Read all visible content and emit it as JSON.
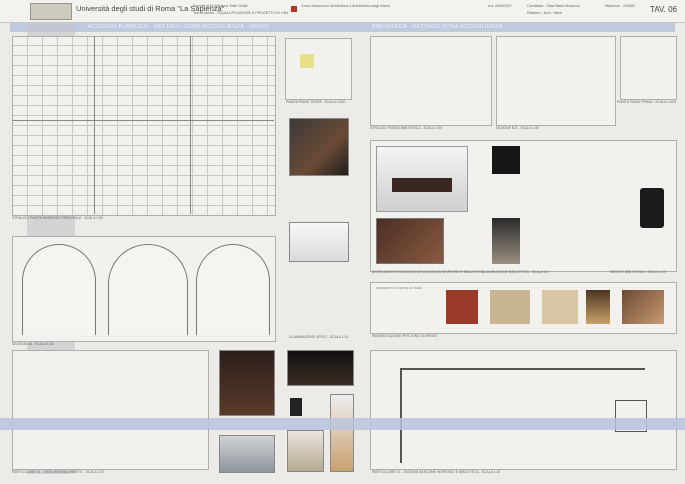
{
  "header": {
    "university": "Università degli studi di Roma \"La Sapienza\"",
    "faculty": "Facoltà di Architettura 'Valle Giulia'",
    "course": "Corso di laurea in Architettura e Architettura degli interni",
    "thesis": "Tesi di laurea - RIQUALIFICAZIONE E PROGETTO DI UNA BIBLIOTECA COMUNALE NELL'EX CONVENTO DI SANT'AGOSTINO AD ANDRIA, BARI",
    "year": "a.a. 2006/2007",
    "candidate": "Candidata - Elisa Maria Musacco",
    "matricola": "Matricola - 783650",
    "relatore": "Relatore - Arch. Valeri",
    "tav": "TAV. 06"
  },
  "bands": {
    "left_title": "ACCESSO PUBBLICO - DETTAGLI ZONA ACCOGLIENZA - UFFICI",
    "right_title": "BIBLIOTECA - DETTAGLI ZONA ACCOGLIENZA"
  },
  "captions": {
    "plan": "STRALCIO PIANTA INGRESSO PRINCIPALE - SCALA 1:50",
    "pianta_terra": "PIANTA PIANO TERRA - SCALA 1:500",
    "section": "SEZIONE AA - SCALA 1:50",
    "illum_uffici": "ILLUMINAZIONE UFFICI - SCALA 1:10",
    "detail_left": "PARTICOLARE 01 - VISTA INTERNA PARETE - SCALA 1:20",
    "bib_pianta": "STRALCIO PIANTA BIBLIOTECA - SCALA 1:50",
    "sezione_bb": "SEZIONE B-B - SCALA 1:50",
    "pianta_primo": "PIANTA PIANO PRIMO - SCALA 1:500",
    "arredamento": "ARREDAMENTO BANCONE ACCOGLIENZA INGRESSO E BIBLIOTECA",
    "illum_bib": "ILLUMINAZIONE BIBLIOTECA - SCALA 1:5",
    "sedute": "SEDUTE BIBLIOTECA - SCALA 1:20",
    "pavimentazione": "PAVIMENTAZIONE PER ZONE DI ARRIVO",
    "detail_right": "PARTICOLARE 02 - SEZIONE BANCONE INGRESSO E BIBLIOTECA - SCALA 1:10",
    "pav_text": "PAVIMENTO IN PIETRA DI TRANI"
  },
  "colors": {
    "band": "#b9c4dd",
    "strip": "#c2c0c6",
    "accent_red": "#b8322a"
  }
}
